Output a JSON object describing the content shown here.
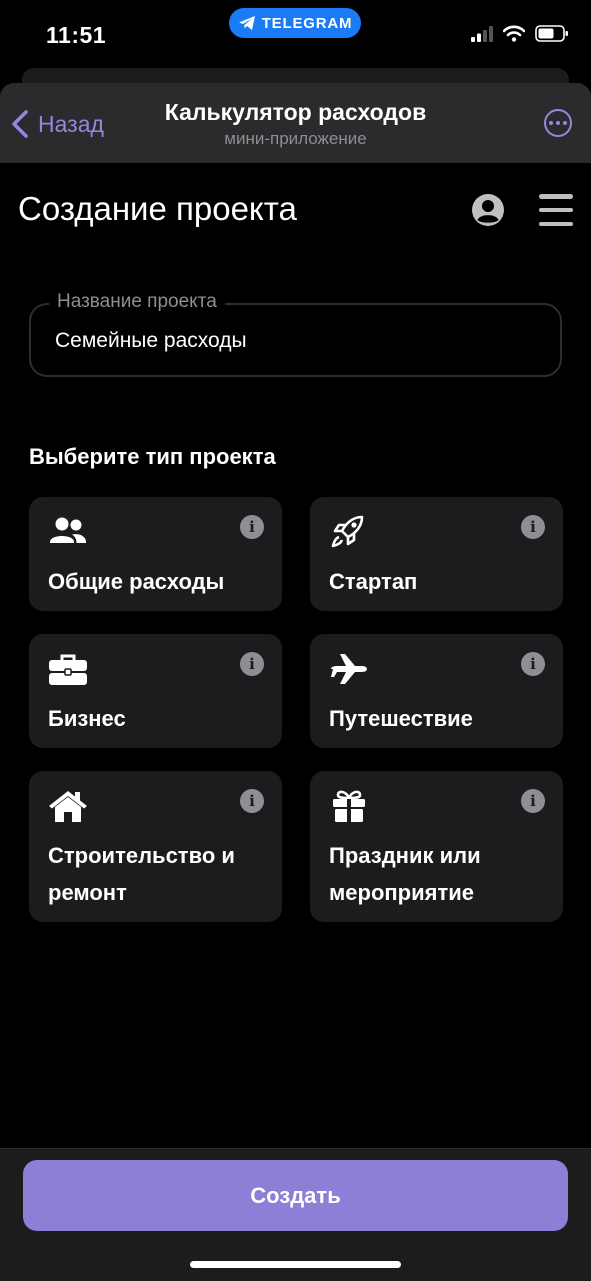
{
  "status": {
    "time": "11:51",
    "telegram_label": "TELEGRAM"
  },
  "nav": {
    "back_label": "Назад",
    "title": "Калькулятор расходов",
    "subtitle": "мини-приложение"
  },
  "page": {
    "title": "Создание проекта"
  },
  "form": {
    "name_label": "Название проекта",
    "name_value": "Семейные расходы"
  },
  "project_types": {
    "heading": "Выберите тип проекта",
    "items": [
      {
        "label": "Общие расходы",
        "icon": "users-icon"
      },
      {
        "label": "Стартап",
        "icon": "rocket-icon"
      },
      {
        "label": "Бизнес",
        "icon": "briefcase-icon"
      },
      {
        "label": "Путешествие",
        "icon": "plane-icon"
      },
      {
        "label": "Строительство и ремонт",
        "icon": "house-icon"
      },
      {
        "label": "Праздник или мероприятие",
        "icon": "gift-icon"
      }
    ],
    "info_glyph": "i"
  },
  "actions": {
    "create_label": "Создать"
  },
  "colors": {
    "accent": "#9b84e0",
    "button": "#8f7ed6",
    "card": "#1c1c1e",
    "telegram": "#1a7cf5"
  }
}
